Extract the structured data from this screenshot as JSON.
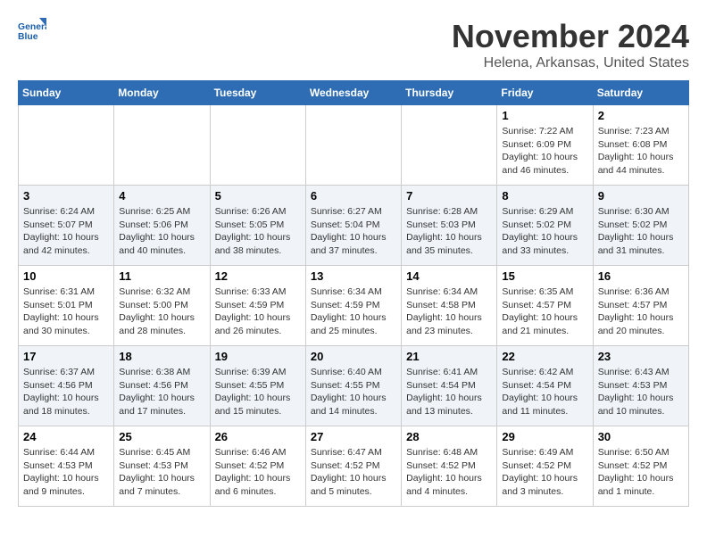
{
  "header": {
    "logo_line1": "General",
    "logo_line2": "Blue",
    "month_title": "November 2024",
    "location": "Helena, Arkansas, United States"
  },
  "weekdays": [
    "Sunday",
    "Monday",
    "Tuesday",
    "Wednesday",
    "Thursday",
    "Friday",
    "Saturday"
  ],
  "weeks": [
    [
      {
        "day": "",
        "info": ""
      },
      {
        "day": "",
        "info": ""
      },
      {
        "day": "",
        "info": ""
      },
      {
        "day": "",
        "info": ""
      },
      {
        "day": "",
        "info": ""
      },
      {
        "day": "1",
        "info": "Sunrise: 7:22 AM\nSunset: 6:09 PM\nDaylight: 10 hours and 46 minutes."
      },
      {
        "day": "2",
        "info": "Sunrise: 7:23 AM\nSunset: 6:08 PM\nDaylight: 10 hours and 44 minutes."
      }
    ],
    [
      {
        "day": "3",
        "info": "Sunrise: 6:24 AM\nSunset: 5:07 PM\nDaylight: 10 hours and 42 minutes."
      },
      {
        "day": "4",
        "info": "Sunrise: 6:25 AM\nSunset: 5:06 PM\nDaylight: 10 hours and 40 minutes."
      },
      {
        "day": "5",
        "info": "Sunrise: 6:26 AM\nSunset: 5:05 PM\nDaylight: 10 hours and 38 minutes."
      },
      {
        "day": "6",
        "info": "Sunrise: 6:27 AM\nSunset: 5:04 PM\nDaylight: 10 hours and 37 minutes."
      },
      {
        "day": "7",
        "info": "Sunrise: 6:28 AM\nSunset: 5:03 PM\nDaylight: 10 hours and 35 minutes."
      },
      {
        "day": "8",
        "info": "Sunrise: 6:29 AM\nSunset: 5:02 PM\nDaylight: 10 hours and 33 minutes."
      },
      {
        "day": "9",
        "info": "Sunrise: 6:30 AM\nSunset: 5:02 PM\nDaylight: 10 hours and 31 minutes."
      }
    ],
    [
      {
        "day": "10",
        "info": "Sunrise: 6:31 AM\nSunset: 5:01 PM\nDaylight: 10 hours and 30 minutes."
      },
      {
        "day": "11",
        "info": "Sunrise: 6:32 AM\nSunset: 5:00 PM\nDaylight: 10 hours and 28 minutes."
      },
      {
        "day": "12",
        "info": "Sunrise: 6:33 AM\nSunset: 4:59 PM\nDaylight: 10 hours and 26 minutes."
      },
      {
        "day": "13",
        "info": "Sunrise: 6:34 AM\nSunset: 4:59 PM\nDaylight: 10 hours and 25 minutes."
      },
      {
        "day": "14",
        "info": "Sunrise: 6:34 AM\nSunset: 4:58 PM\nDaylight: 10 hours and 23 minutes."
      },
      {
        "day": "15",
        "info": "Sunrise: 6:35 AM\nSunset: 4:57 PM\nDaylight: 10 hours and 21 minutes."
      },
      {
        "day": "16",
        "info": "Sunrise: 6:36 AM\nSunset: 4:57 PM\nDaylight: 10 hours and 20 minutes."
      }
    ],
    [
      {
        "day": "17",
        "info": "Sunrise: 6:37 AM\nSunset: 4:56 PM\nDaylight: 10 hours and 18 minutes."
      },
      {
        "day": "18",
        "info": "Sunrise: 6:38 AM\nSunset: 4:56 PM\nDaylight: 10 hours and 17 minutes."
      },
      {
        "day": "19",
        "info": "Sunrise: 6:39 AM\nSunset: 4:55 PM\nDaylight: 10 hours and 15 minutes."
      },
      {
        "day": "20",
        "info": "Sunrise: 6:40 AM\nSunset: 4:55 PM\nDaylight: 10 hours and 14 minutes."
      },
      {
        "day": "21",
        "info": "Sunrise: 6:41 AM\nSunset: 4:54 PM\nDaylight: 10 hours and 13 minutes."
      },
      {
        "day": "22",
        "info": "Sunrise: 6:42 AM\nSunset: 4:54 PM\nDaylight: 10 hours and 11 minutes."
      },
      {
        "day": "23",
        "info": "Sunrise: 6:43 AM\nSunset: 4:53 PM\nDaylight: 10 hours and 10 minutes."
      }
    ],
    [
      {
        "day": "24",
        "info": "Sunrise: 6:44 AM\nSunset: 4:53 PM\nDaylight: 10 hours and 9 minutes."
      },
      {
        "day": "25",
        "info": "Sunrise: 6:45 AM\nSunset: 4:53 PM\nDaylight: 10 hours and 7 minutes."
      },
      {
        "day": "26",
        "info": "Sunrise: 6:46 AM\nSunset: 4:52 PM\nDaylight: 10 hours and 6 minutes."
      },
      {
        "day": "27",
        "info": "Sunrise: 6:47 AM\nSunset: 4:52 PM\nDaylight: 10 hours and 5 minutes."
      },
      {
        "day": "28",
        "info": "Sunrise: 6:48 AM\nSunset: 4:52 PM\nDaylight: 10 hours and 4 minutes."
      },
      {
        "day": "29",
        "info": "Sunrise: 6:49 AM\nSunset: 4:52 PM\nDaylight: 10 hours and 3 minutes."
      },
      {
        "day": "30",
        "info": "Sunrise: 6:50 AM\nSunset: 4:52 PM\nDaylight: 10 hours and 1 minute."
      }
    ]
  ]
}
